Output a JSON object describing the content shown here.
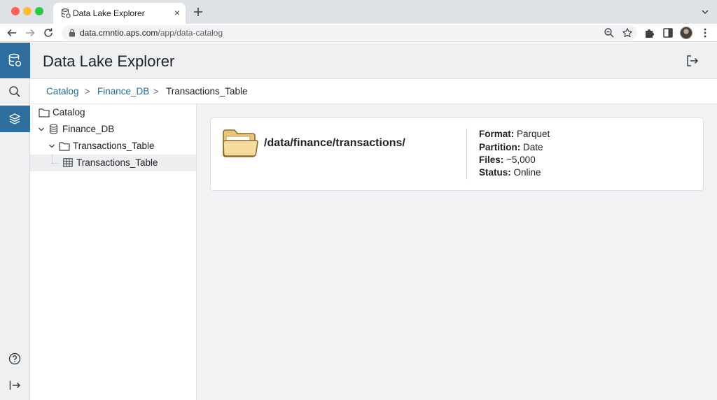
{
  "browser": {
    "tab_title": "Data Lake Explorer",
    "tab_close": "×",
    "url_host": "data.crnntio.aps.com",
    "url_path": "/app/data-catalog"
  },
  "app": {
    "title": "Data Lake Explorer"
  },
  "breadcrumb": {
    "items": [
      "Catalog",
      "Finance_DB",
      "Transactions_Table"
    ],
    "separator": ">"
  },
  "tree": {
    "items": [
      {
        "label": "Catalog",
        "icon": "folder-icon"
      },
      {
        "label": "Finance_DB",
        "icon": "database-icon",
        "expanded": true
      },
      {
        "label": "Transactions_Table",
        "icon": "folder-icon",
        "expanded": true
      },
      {
        "label": "Transactions_Table",
        "icon": "table-icon",
        "selected": true
      }
    ]
  },
  "details": {
    "path": "/data/finance/transactions/",
    "properties": [
      {
        "key": "Format:",
        "value": "Parquet"
      },
      {
        "key": "Partition:",
        "value": "Date"
      },
      {
        "key": "Files:",
        "value": "~5,000"
      },
      {
        "key": "Status:",
        "value": "Online"
      }
    ]
  },
  "colors": {
    "accent": "#2e6e9e",
    "link": "#2c6a8f",
    "folder": "#f3d89a"
  }
}
